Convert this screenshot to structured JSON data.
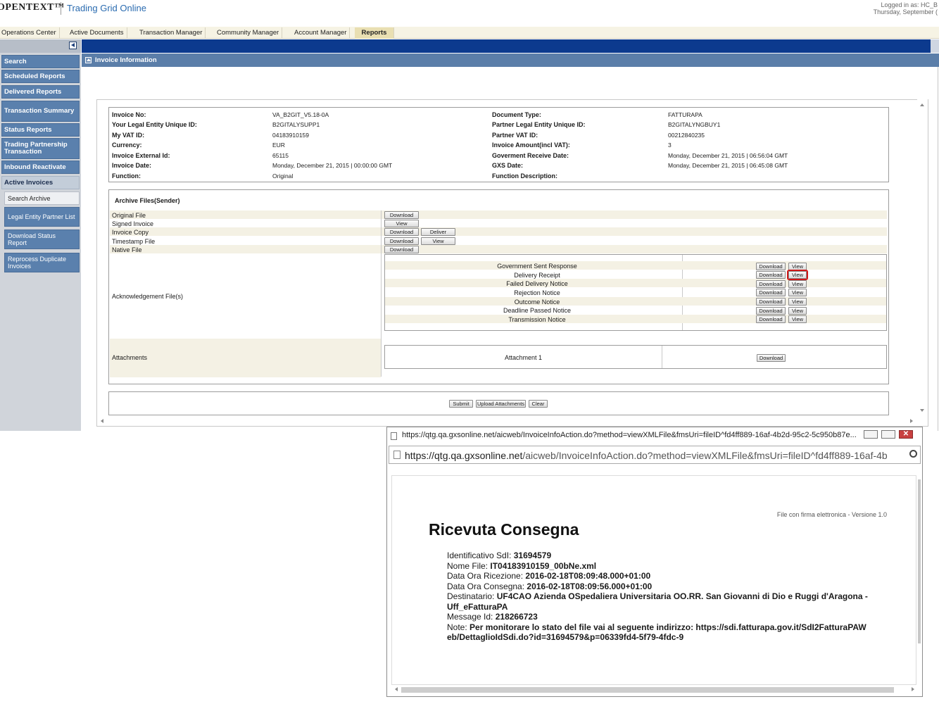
{
  "header": {
    "logo": "OPENTEXT™",
    "product": "Trading Grid Online",
    "login_line1": "Logged in as: HC_B",
    "login_line2": "Thursday, September ("
  },
  "tabs": [
    {
      "label": "Operations Center"
    },
    {
      "label": "Active Documents"
    },
    {
      "label": "Transaction Manager"
    },
    {
      "label": "Community Manager"
    },
    {
      "label": "Account Manager"
    },
    {
      "label": "Reports"
    }
  ],
  "sidebar": {
    "items": [
      {
        "label": "Search"
      },
      {
        "label": "Scheduled Reports"
      },
      {
        "label": "Delivered Reports"
      },
      {
        "label": "Transaction Summary"
      },
      {
        "label": "Status Reports"
      },
      {
        "label": "Trading Partnership Transaction"
      },
      {
        "label": "Inbound Reactivate"
      }
    ],
    "group_heading": "Active Invoices",
    "sub_items": [
      {
        "label": "Search Archive"
      },
      {
        "label": "Legal Entity Partner List"
      },
      {
        "label": "Download Status Report"
      },
      {
        "label": "Reprocess Duplicate Invoices"
      }
    ]
  },
  "section_title": "Invoice Information",
  "invoice": {
    "left": [
      {
        "label": "Invoice No:",
        "value": "VA_B2GIT_V5.18-0A"
      },
      {
        "label": "Your Legal Entity Unique ID:",
        "value": "B2GITALYSUPP1"
      },
      {
        "label": "My VAT ID:",
        "value": "04183910159"
      },
      {
        "label": "Currency:",
        "value": "EUR"
      },
      {
        "label": "Invoice External Id:",
        "value": "65115"
      },
      {
        "label": "Invoice Date:",
        "value": "Monday, December 21, 2015 | 00:00:00 GMT"
      },
      {
        "label": "Function:",
        "value": "Original"
      }
    ],
    "right": [
      {
        "label": "Document Type:",
        "value": "FATTURAPA"
      },
      {
        "label": "Partner Legal Entity Unique ID:",
        "value": "B2GITALYNGBUY1"
      },
      {
        "label": "Partner VAT ID:",
        "value": "00212840235"
      },
      {
        "label": "Invoice Amount(incl VAT):",
        "value": "3"
      },
      {
        "label": "Goverment Receive Date:",
        "value": "Monday, December 21, 2015 | 06:56:04 GMT"
      },
      {
        "label": "GXS Date:",
        "value": "Monday, December 21, 2015 | 06:45:08 GMT"
      },
      {
        "label": "Function Description:",
        "value": ""
      }
    ]
  },
  "archive": {
    "heading": "Archive Files(Sender)",
    "files": [
      {
        "label": "Original File",
        "buttons": [
          "Download"
        ]
      },
      {
        "label": "Signed Invoice",
        "buttons": [
          "View"
        ]
      },
      {
        "label": "Invoice Copy",
        "buttons": [
          "Download",
          "Deliver"
        ]
      },
      {
        "label": "Timestamp File",
        "buttons": [
          "Download",
          "View"
        ]
      },
      {
        "label": "Native File",
        "buttons": [
          "Download"
        ]
      }
    ],
    "ack_label": "Acknowledgement File(s)",
    "ack_files": [
      {
        "label": "Government Sent Response"
      },
      {
        "label": "Delivery Receipt"
      },
      {
        "label": "Failed Delivery Notice"
      },
      {
        "label": "Rejection Notice"
      },
      {
        "label": "Outcome Notice"
      },
      {
        "label": "Deadline Passed Notice"
      },
      {
        "label": "Transmission Notice"
      }
    ],
    "download_label": "Download",
    "view_label": "View",
    "attachments_label": "Attachments",
    "attachment_name": "Attachment 1"
  },
  "actions": {
    "submit": "Submit",
    "upload": "Upload Attachments",
    "clear": "Clear"
  },
  "popup": {
    "title": "https://qtg.qa.gxsonline.net/aicweb/InvoiceInfoAction.do?method=viewXMLFile&fmsUri=fileID^fd4ff889-16af-4b2d-95c2-5c950b87e...",
    "address_host": "https://qtg.qa.gxsonline.net",
    "address_path": "/aicweb/InvoiceInfoAction.do?method=viewXMLFile&fmsUri=fileID^fd4ff889-16af-4b",
    "doc_note": "File con firma elettronica - Versione 1.0",
    "doc_title": "Ricevuta Consegna",
    "fields": [
      {
        "key": "Identificativo SdI:",
        "value": "31694579"
      },
      {
        "key": "Nome File:",
        "value": "IT04183910159_00bNe.xml"
      },
      {
        "key": "Data Ora Ricezione:",
        "value": "2016-02-18T08:09:48.000+01:00"
      },
      {
        "key": "Data Ora Consegna:",
        "value": "2016-02-18T08:09:56.000+01:00"
      },
      {
        "key": "Destinatario:",
        "value": "UF4CAO Azienda OSpedaliera Universitaria OO.RR. San Giovanni di Dio e Ruggi d'Aragona - Uff_eFatturaPA"
      },
      {
        "key": "Message Id:",
        "value": "218266723"
      },
      {
        "key": "Note:",
        "value": "Per monitorare lo stato del file vai al seguente indirizzo: https://sdi.fatturapa.gov.it/SdI2FatturaPAWeb/DettaglioIdSdi.do?id=31694579&p=06339fd4-5f79-4fdc-9"
      }
    ]
  }
}
